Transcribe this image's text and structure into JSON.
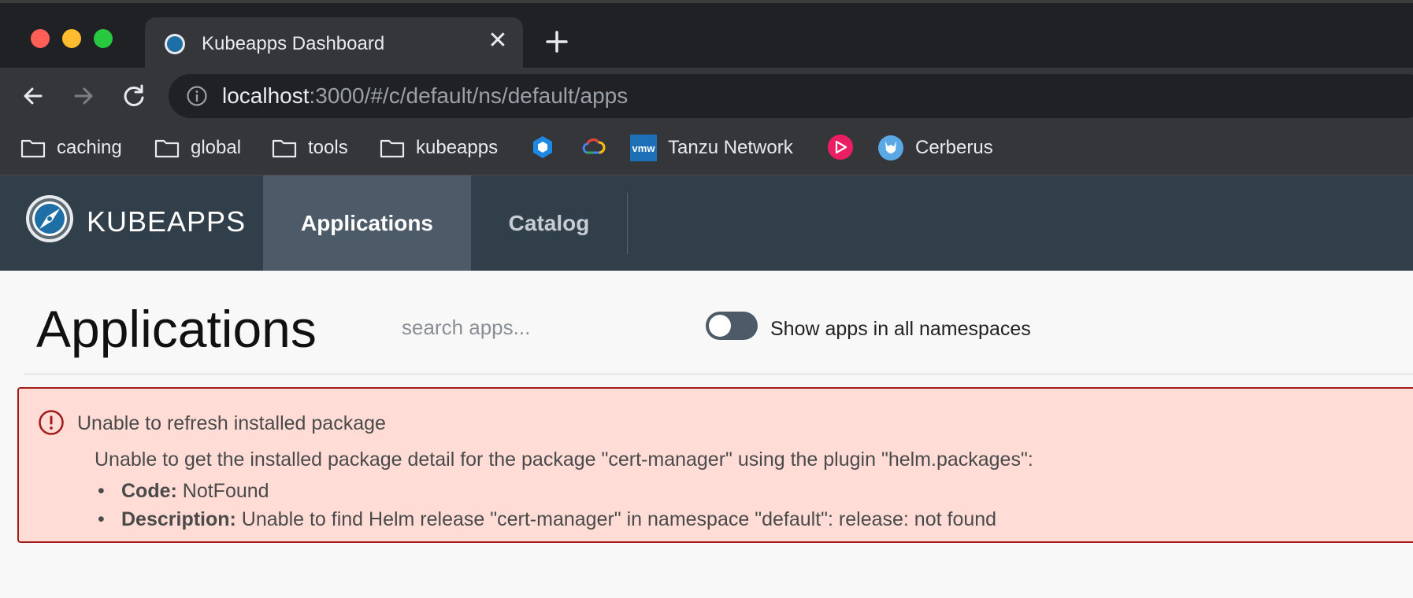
{
  "browser": {
    "tab": {
      "title": "Kubeapps Dashboard",
      "close_glyph": "✕"
    },
    "address": {
      "host": "localhost",
      "path": ":3000/#/c/default/ns/default/apps"
    },
    "bookmarks": [
      {
        "label": "caching",
        "icon": "folder-icon"
      },
      {
        "label": "global",
        "icon": "folder-icon"
      },
      {
        "label": "tools",
        "icon": "folder-icon"
      },
      {
        "label": "kubeapps",
        "icon": "folder-icon"
      },
      {
        "label": "",
        "icon": "hexagon-bookmark-icon"
      },
      {
        "label": "",
        "icon": "google-cloud-icon"
      },
      {
        "label": "Tanzu Network",
        "icon": "vmware-icon",
        "icon_text": "vmw"
      },
      {
        "label": "",
        "icon": "play-bookmark-icon"
      },
      {
        "label": "Cerberus",
        "icon": "cerberus-icon"
      }
    ]
  },
  "app": {
    "brand": "KUBEAPPS",
    "nav": {
      "applications": "Applications",
      "catalog": "Catalog"
    }
  },
  "page": {
    "title": "Applications",
    "search_placeholder": "search apps...",
    "toggle": {
      "label": "Show apps in all namespaces",
      "on": false
    }
  },
  "alert": {
    "title": "Unable to refresh installed package",
    "message": "Unable to get the installed package detail for the package \"cert-manager\" using the plugin \"helm.packages\":",
    "details": [
      {
        "key": "Code:",
        "value": " NotFound"
      },
      {
        "key": "Description:",
        "value": " Unable to find Helm release \"cert-manager\" in namespace \"default\": release: not found"
      }
    ]
  },
  "colors": {
    "nav_bg": "#313f4b",
    "nav_active": "#4d5b68",
    "alert_bg": "#ffdcd6",
    "alert_border": "#a31c1c"
  }
}
